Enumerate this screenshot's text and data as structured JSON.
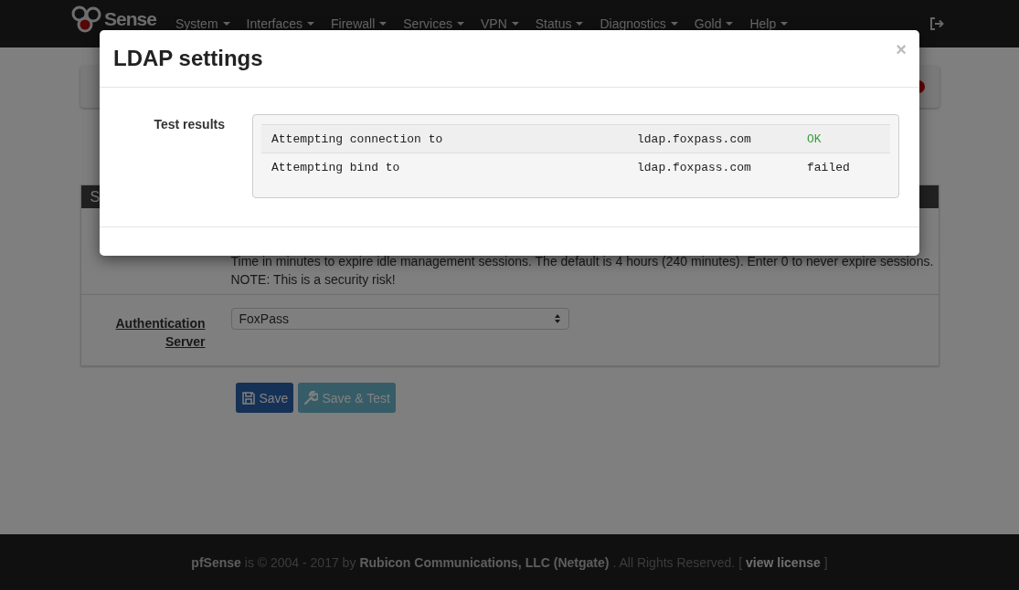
{
  "navbar": {
    "logo_text": "Sense",
    "menu": [
      {
        "label": "System"
      },
      {
        "label": "Interfaces"
      },
      {
        "label": "Firewall"
      },
      {
        "label": "Services"
      },
      {
        "label": "VPN"
      },
      {
        "label": "Status"
      },
      {
        "label": "Diagnostics"
      },
      {
        "label": "Gold"
      },
      {
        "label": "Help"
      }
    ]
  },
  "page": {
    "panel_title": "S",
    "session_note": "Time in minutes to expire idle management sessions. The default is 4 hours (240 minutes). Enter 0 to never expire sessions.",
    "session_warning": "NOTE: This is a security risk!",
    "auth_label": "Authentication Server",
    "auth_value": "FoxPass",
    "buttons": [
      {
        "label": "Save",
        "kind": "primary"
      },
      {
        "label": "Save & Test",
        "kind": "info"
      }
    ]
  },
  "modal": {
    "title": "LDAP settings",
    "close": "×",
    "label": "Test results",
    "rows": [
      {
        "action": "Attempting connection to",
        "host": "ldap.foxpass.com",
        "result": "OK",
        "color": "#3c9b3c"
      },
      {
        "action": "Attempting bind to",
        "host": "ldap.foxpass.com",
        "result": "failed",
        "color": "#222222"
      }
    ]
  },
  "footer": [
    {
      "text": "pfSense",
      "kind": "strong"
    },
    {
      "text": "is © 2004 - 2017 by",
      "kind": "plain"
    },
    {
      "text": "Rubicon Communications, LLC (Netgate)",
      "kind": "strong"
    },
    {
      "text": ". All Rights Reserved. [",
      "kind": "plain"
    },
    {
      "text": "view license",
      "kind": "link"
    },
    {
      "text": "]",
      "kind": "plain"
    }
  ]
}
